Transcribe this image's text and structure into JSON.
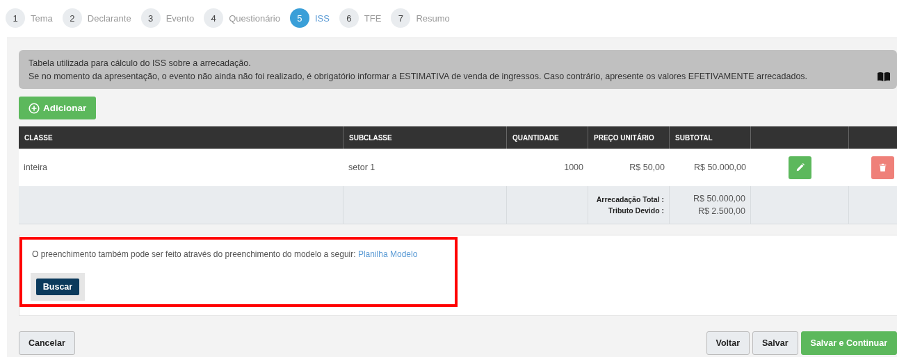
{
  "steps": [
    {
      "number": "1",
      "label": "Tema",
      "selected": false
    },
    {
      "number": "2",
      "label": "Declarante",
      "selected": false
    },
    {
      "number": "3",
      "label": "Evento",
      "selected": false
    },
    {
      "number": "4",
      "label": "Questionário",
      "selected": false
    },
    {
      "number": "5",
      "label": "ISS",
      "selected": true
    },
    {
      "number": "6",
      "label": "TFE",
      "selected": false
    },
    {
      "number": "7",
      "label": "Resumo",
      "selected": false
    }
  ],
  "info": {
    "lines": [
      "Tabela utilizada para cálculo do ISS sobre a arrecadação.",
      "Se no momento da apresentação, o evento não ainda não foi realizado, é obrigatório informar a ESTIMATIVA de venda de ingressos. Caso contrário, apresente os valores EFETIVAMENTE arrecadados."
    ]
  },
  "add_button": "Adicionar",
  "table": {
    "columns": [
      "CLASSE",
      "SUBCLASSE",
      "QUANTIDADE",
      "PREÇO UNITÁRIO",
      "SUBTOTAL"
    ],
    "rows": [
      {
        "classe": "inteira",
        "subclasse": "setor 1",
        "quantidade": "1000",
        "preco_unitario": "R$ 50,00",
        "subtotal": "R$ 50.000,00"
      }
    ],
    "totals": [
      {
        "label": "Arrecadação Total :",
        "value": "R$ 50.000,00"
      },
      {
        "label": "Tributo Devido :",
        "value": "R$ 2.500,00"
      }
    ]
  },
  "template": {
    "text": "O preenchimento também pode ser feito através do preenchimento do modelo a seguir:",
    "link": "Planilha Modelo",
    "button": "Buscar"
  },
  "footer": {
    "left": [
      "Cancelar"
    ],
    "right": [
      {
        "label": "Voltar",
        "kind": "default"
      },
      {
        "label": "Salvar",
        "kind": "default"
      },
      {
        "label": "Salvar e Continuar",
        "kind": "primary"
      }
    ]
  }
}
